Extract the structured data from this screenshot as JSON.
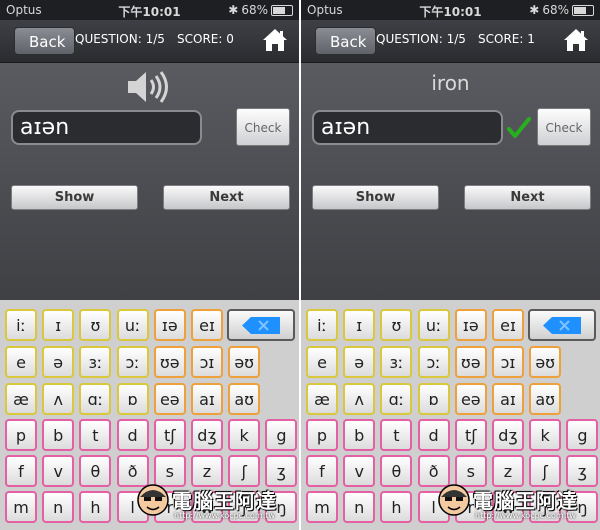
{
  "status": {
    "carrier": "Optus",
    "time": "下午10:01",
    "battery": "68%",
    "battery_level": 0.68
  },
  "nav": {
    "back_label": "Back",
    "home_icon": "home-icon"
  },
  "screens": [
    {
      "question": "QUESTION: 1/5",
      "score": "SCORE: 0",
      "answer_value": "aɪən",
      "word": "",
      "correct": false
    },
    {
      "question": "QUESTION: 1/5",
      "score": "SCORE: 1",
      "answer_value": "aɪən",
      "word": "iron",
      "correct": true
    }
  ],
  "buttons": {
    "check": "Check",
    "show": "Show",
    "next": "Next"
  },
  "keyboard": {
    "row1": [
      "iː",
      "ɪ",
      "ʊ",
      "uː",
      "ɪə",
      "eɪ"
    ],
    "row2": [
      "e",
      "ə",
      "ɜː",
      "ɔː",
      "ʊə",
      "ɔɪ",
      "əʊ"
    ],
    "row3": [
      "æ",
      "ʌ",
      "ɑː",
      "ɒ",
      "eə",
      "aɪ",
      "aʊ"
    ],
    "row4": [
      "p",
      "b",
      "t",
      "d",
      "tʃ",
      "dʒ",
      "k",
      "g"
    ],
    "row5": [
      "f",
      "v",
      "θ",
      "ð",
      "s",
      "z",
      "ʃ",
      "ʒ"
    ],
    "row6": [
      "m",
      "n",
      "h",
      "l",
      "r",
      "w",
      "j",
      "ŋ"
    ],
    "delete_icon": "backspace-icon"
  },
  "watermark": {
    "text": "電腦王阿達",
    "url": "http://www.kocpc.com.tw"
  },
  "colors": {
    "navbar": "#2f3135",
    "content": "#4a4b4f",
    "check_green": "#27b01e",
    "delete_blue": "#1e90ff"
  }
}
